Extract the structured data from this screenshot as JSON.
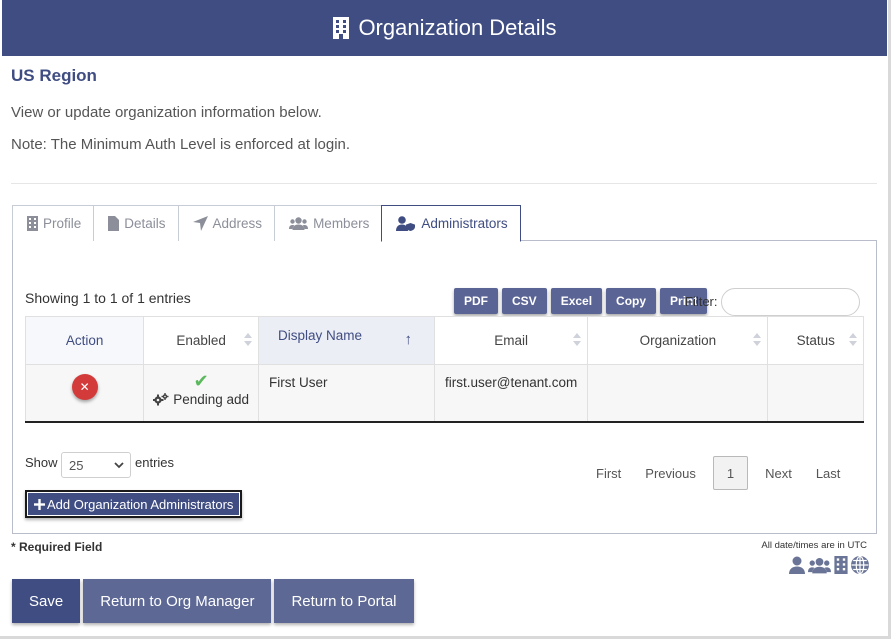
{
  "header": {
    "title": "Organization Details",
    "icon": "building-icon"
  },
  "region": "US Region",
  "intro": {
    "line1": "View or update organization information below.",
    "line2": "Note: The Minimum Auth Level is enforced at login."
  },
  "tabs": [
    {
      "label": "Profile",
      "icon": "building-icon"
    },
    {
      "label": "Details",
      "icon": "file-icon"
    },
    {
      "label": "Address",
      "icon": "location-arrow-icon"
    },
    {
      "label": "Members",
      "icon": "users-icon"
    },
    {
      "label": "Administrators",
      "icon": "user-shield-icon",
      "active": true
    }
  ],
  "table_info": {
    "showing": "Showing 1 to 1 of 1 entries",
    "export_buttons": [
      "PDF",
      "CSV",
      "Excel",
      "Copy",
      "Print"
    ],
    "filter_label": "Filter:",
    "filter_value": ""
  },
  "columns": [
    "Action",
    "Enabled",
    "Display Name",
    "Email",
    "Organization",
    "Status"
  ],
  "sort_indicator": "↑",
  "rows": [
    {
      "enabled_mark": "✔",
      "enabled_status": "Pending add",
      "display_name": "First User",
      "email": "first.user@tenant.com",
      "organization": "",
      "status": ""
    }
  ],
  "length_menu": {
    "show_label": "Show",
    "value": "25",
    "entries_label": "entries"
  },
  "pagination": {
    "first": "First",
    "previous": "Previous",
    "current": "1",
    "next": "Next",
    "last": "Last"
  },
  "add_button": "Add Organization Administrators",
  "required_note": "* Required Field",
  "utc_note": "All date/times are in UTC",
  "footer_buttons": {
    "save": "Save",
    "return_org": "Return to Org Manager",
    "return_portal": "Return to Portal"
  },
  "colors": {
    "primary": "#3f4d82",
    "secondary": "#5d6895",
    "success": "#5cb85c",
    "danger": "#d33b3b"
  }
}
